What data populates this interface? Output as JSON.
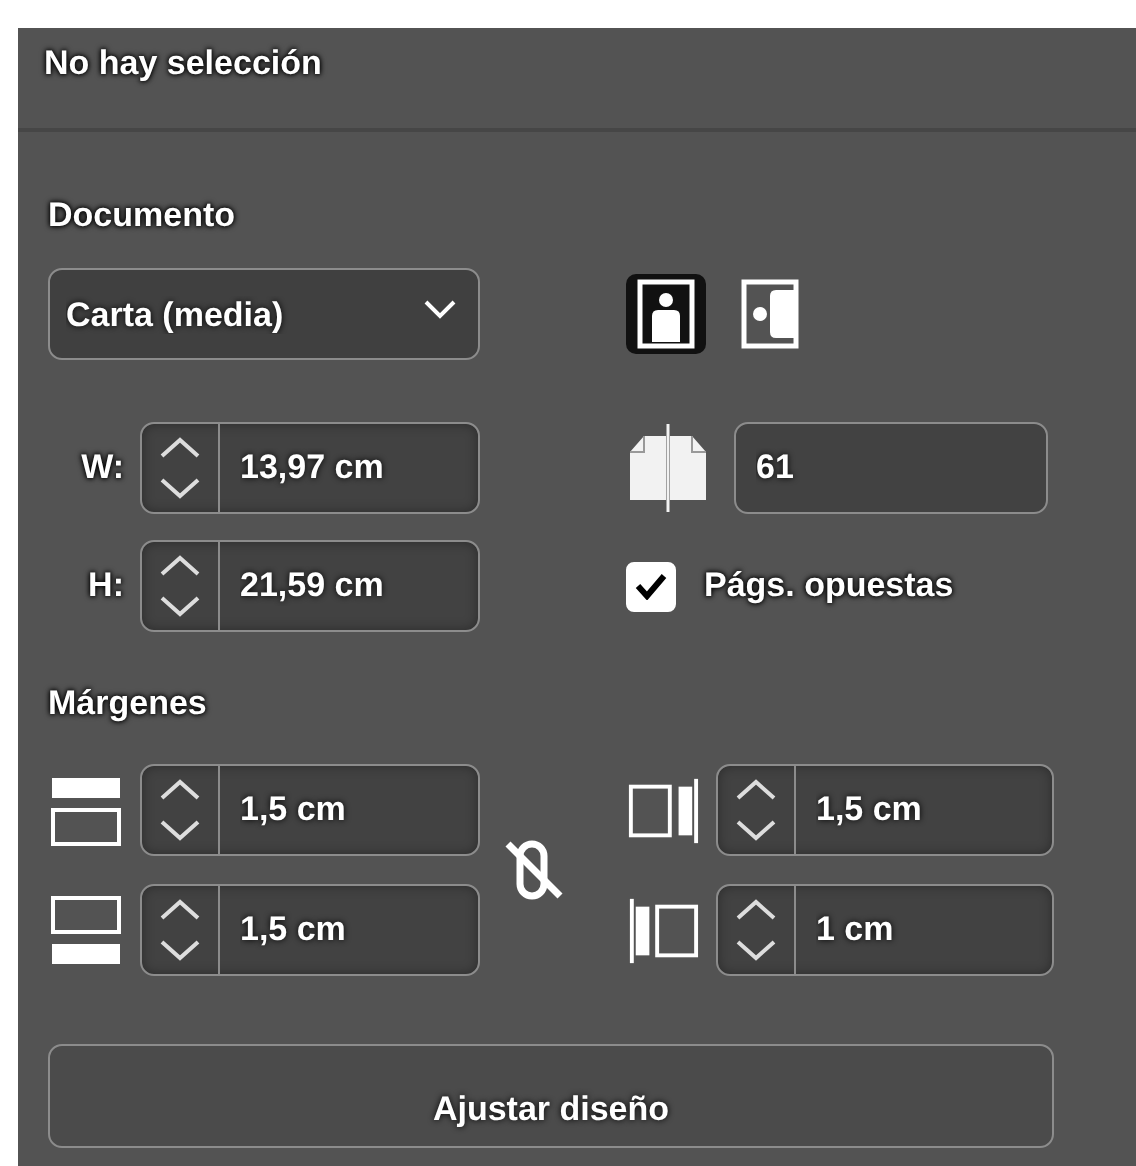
{
  "panel": {
    "title": "No hay selección"
  },
  "document": {
    "heading": "Documento",
    "page_size": {
      "value": "Carta (media)"
    },
    "orientations": [
      {
        "kind": "portrait",
        "selected": true
      },
      {
        "kind": "landscape",
        "selected": false
      }
    ],
    "width": {
      "label": "W:",
      "value": "13,97 cm"
    },
    "height": {
      "label": "H:",
      "value": "21,59 cm"
    },
    "pages": {
      "value": "61"
    },
    "facing_pages": {
      "label": "Págs. opuestas",
      "checked": true
    }
  },
  "margins": {
    "heading": "Márgenes",
    "linked": false,
    "fields": [
      {
        "kind": "top",
        "value": "1,5 cm"
      },
      {
        "kind": "right",
        "value": "1,5 cm"
      },
      {
        "kind": "bottom",
        "value": "1,5 cm"
      },
      {
        "kind": "left",
        "value": "1 cm"
      }
    ]
  },
  "buttons": [
    {
      "label": "Ajustar diseño"
    }
  ]
}
